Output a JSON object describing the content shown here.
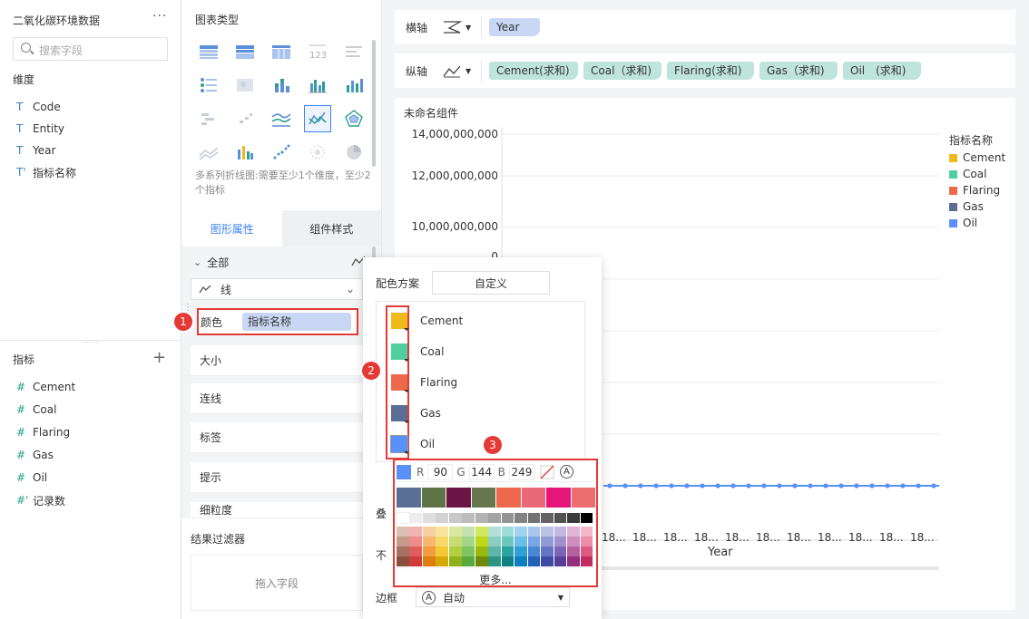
{
  "data_panel": {
    "dataset_title": "二氧化碳环境数据",
    "more": "···",
    "search_placeholder": "搜索字段",
    "dimension_label": "维度",
    "dimensions": [
      {
        "type": "T",
        "name": "Code"
      },
      {
        "type": "T",
        "name": "Entity"
      },
      {
        "type": "T",
        "name": "Year"
      },
      {
        "type": "T'",
        "name": "指标名称"
      }
    ],
    "measure_label": "指标",
    "add": "+",
    "measures": [
      {
        "type": "#",
        "name": "Cement"
      },
      {
        "type": "#",
        "name": "Coal"
      },
      {
        "type": "#",
        "name": "Flaring"
      },
      {
        "type": "#",
        "name": "Gas"
      },
      {
        "type": "#",
        "name": "Oil"
      },
      {
        "type": "#'",
        "name": "记录数"
      }
    ]
  },
  "chart_type_panel": {
    "title": "图表类型",
    "description": "多系列折线图:需要至少1个维度，至少2个指标",
    "tabs": [
      "图形属性",
      "组件样式"
    ],
    "all_label": "全部",
    "mark_type": "线",
    "color_label": "颜色",
    "color_field": "指标名称",
    "props": [
      "大小",
      "连线",
      "标签",
      "提示",
      "细粒度"
    ],
    "filter_title": "结果过滤器",
    "filter_drop": "拖入字段"
  },
  "axes": {
    "x_label": "横轴",
    "x_fields": [
      "Year"
    ],
    "y_label": "纵轴",
    "y_fields": [
      "Cement(求和)",
      "Coal（求和)",
      "Flaring(求和)",
      "Gas（求和)",
      "Oil　(求和)"
    ]
  },
  "chart": {
    "component_title": "未命名组件",
    "y_ticks": [
      "14,000,000,000",
      "12,000,000,000",
      "10,000,000,000"
    ],
    "y_partial_tick": "0",
    "x_ticks": [
      "18...",
      "18...",
      "18...",
      "18...",
      "18...",
      "18...",
      "18...",
      "18...",
      "18...",
      "18...",
      "18..."
    ],
    "x_title": "Year",
    "legend_title": "指标名称",
    "legend": [
      {
        "name": "Cement",
        "color": "#f0b91a"
      },
      {
        "name": "Coal",
        "color": "#4fcf9f"
      },
      {
        "name": "Flaring",
        "color": "#ec6a4b"
      },
      {
        "name": "Gas",
        "color": "#5b6e93"
      },
      {
        "name": "Oil",
        "color": "#5a90f9"
      }
    ],
    "line_color": "#5a90f9"
  },
  "color_popup": {
    "scheme_label": "配色方案",
    "scheme_value": "自定义",
    "series": [
      {
        "name": "Cement",
        "color": "#f0b91a"
      },
      {
        "name": "Coal",
        "color": "#4fcf9f"
      },
      {
        "name": "Flaring",
        "color": "#ec6a4b"
      },
      {
        "name": "Gas",
        "color": "#5b6e93"
      },
      {
        "name": "Oil",
        "color": "#5a90f9"
      }
    ],
    "rgb": {
      "r_label": "R",
      "r": "90",
      "g_label": "G",
      "g": "144",
      "b_label": "B",
      "b": "249"
    },
    "auto_symbol": "A",
    "more": "更多...",
    "stack_label": "叠",
    "opacity_label": "不",
    "border_label": "边框",
    "border_value": "自动",
    "theme_colors": [
      "#5b6e93",
      "#5e7447",
      "#6b1547",
      "#66774d",
      "#ec6a4b",
      "#eb6878",
      "#e5157a",
      "#ec6d6d"
    ],
    "gray_row": [
      "#ffffff",
      "#ededed",
      "#dedede",
      "#d2d2d2",
      "#c7c7c7",
      "#bdbdbd",
      "#b3b3b3",
      "#a3a3a3",
      "#939393",
      "#828282",
      "#737373",
      "#636363",
      "#525252",
      "#3b3b3b",
      "#000000"
    ],
    "grid_rows": [
      [
        "#dcbfb3",
        "#f3b3b3",
        "#f8cfa0",
        "#f8e49c",
        "#d9e7a0",
        "#c3e2b0",
        "#d2e85e",
        "#b4dfd9",
        "#9fdcd8",
        "#9fd2ee",
        "#a9c7ee",
        "#bac2e7",
        "#c3b8df",
        "#e0b6d6",
        "#f3b6c8"
      ],
      [
        "#c4988a",
        "#ee8b8b",
        "#f6b870",
        "#f6d96a",
        "#c7dc73",
        "#a3d68a",
        "#bdd71a",
        "#8acec3",
        "#6dc7c1",
        "#6dbde6",
        "#7aa7e3",
        "#919bd8",
        "#a090cc",
        "#cf8dc0",
        "#ec8ea9"
      ],
      [
        "#a7705f",
        "#e05d5d",
        "#f29e3f",
        "#f2cb34",
        "#b2cf42",
        "#7fc662",
        "#98b80f",
        "#5cb7aa",
        "#2ca3a0",
        "#2f9fd9",
        "#4a87d4",
        "#6674c4",
        "#7a65b4",
        "#b55fa1",
        "#dc5a83"
      ],
      [
        "#8a4f3e",
        "#cf3b3b",
        "#e07d10",
        "#d6a90a",
        "#8fb01b",
        "#58a83b",
        "#6e8a08",
        "#2e9383",
        "#0e8280",
        "#0b7fc0",
        "#2462b6",
        "#3d4ba6",
        "#563f94",
        "#922f7f",
        "#c22d5f"
      ]
    ]
  },
  "annotations": [
    "1",
    "2",
    "3"
  ]
}
